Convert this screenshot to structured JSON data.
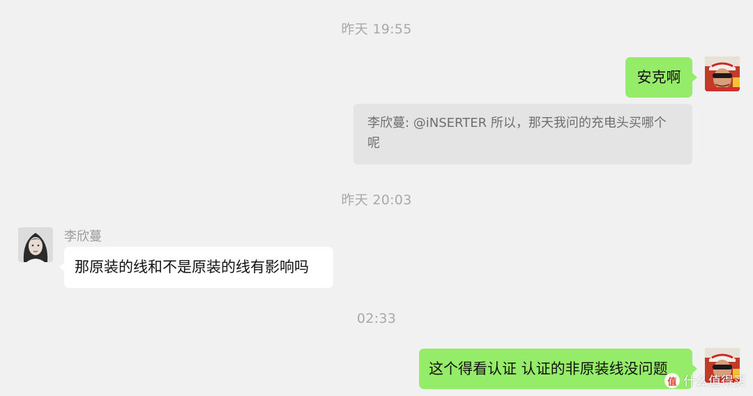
{
  "timestamps": {
    "t1": "昨天 19:55",
    "t2": "昨天 20:03",
    "t3": "02:33"
  },
  "messages": {
    "m1": {
      "from": "self",
      "text": "安克啊"
    },
    "quote": {
      "text_line1": "李欣蔓: @iNSERTER 所以，那天我问的充电头买哪个",
      "text_line2": "呢"
    },
    "m2": {
      "from": "other",
      "sender": "李欣蔓",
      "text": "那原装的线和不是原装的线有影响吗"
    },
    "m3": {
      "from": "self",
      "text": "这个得看认证 认证的非原装线没问题"
    }
  },
  "watermark": {
    "badge": "值",
    "text": "什么值得买"
  },
  "colors": {
    "background": "#f1f1f1",
    "self_bubble": "#95ec69",
    "other_bubble": "#ffffff",
    "quote_bg": "#e4e4e4",
    "timestamp": "#a8a8a8"
  }
}
